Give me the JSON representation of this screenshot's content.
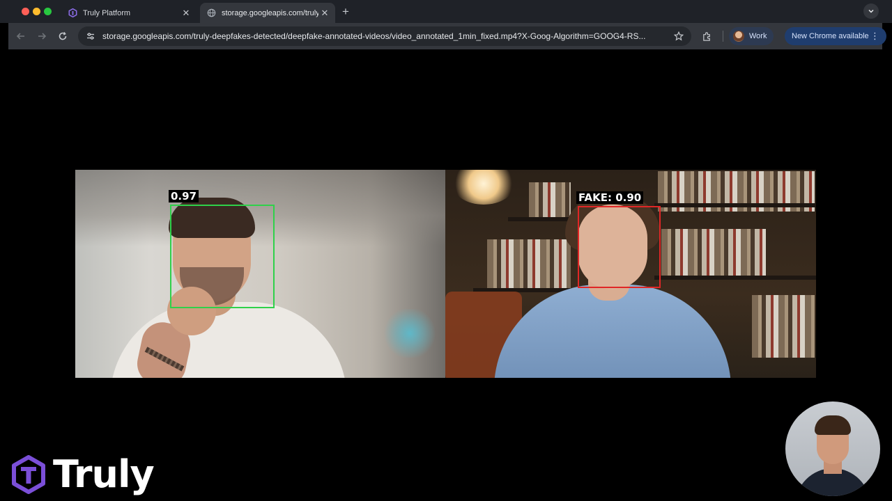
{
  "browser": {
    "tabs": [
      {
        "title": "Truly Platform",
        "favicon": "truly-hex-icon",
        "active": false
      },
      {
        "title": "storage.googleapis.com/truly",
        "favicon": "globe-icon",
        "active": true
      }
    ],
    "new_tab_label": "+",
    "url": "storage.googleapis.com/truly-deepfakes-detected/deepfake-annotated-videos/video_annotated_1min_fixed.mp4?X-Goog-Algorithm=GOOG4-RS...",
    "profile_label": "Work",
    "update_label": "New Chrome available",
    "colors": {
      "tabstrip": "#1f2228",
      "toolbar": "#34373d",
      "update_chip": "#1f3d6e"
    }
  },
  "video": {
    "detections": [
      {
        "label": "0.97",
        "status": "real",
        "color": "#2fd14a"
      },
      {
        "label": "FAKE: 0.90",
        "status": "fake",
        "color": "#e02626"
      }
    ]
  },
  "branding": {
    "logo_text": "Truly",
    "logo_color": "#7b4fd8"
  }
}
